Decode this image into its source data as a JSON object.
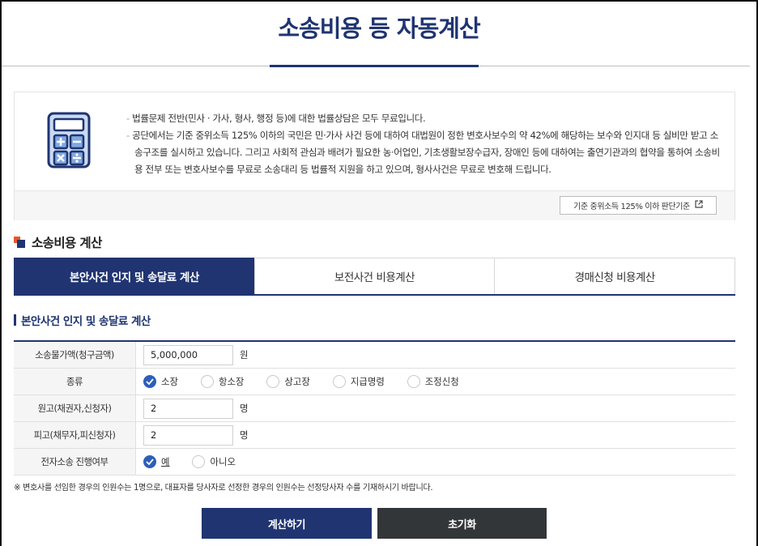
{
  "page": {
    "title": "소송비용 등 자동계산"
  },
  "info": {
    "lines": [
      "법률문제 전반(민사 · 가사, 형사, 행정 등)에 대한 법률상담은 모두 무료입니다.",
      "공단에서는 기준 중위소득 125% 이하의 국민은 민·가사 사건 등에 대하여 대법원이 정한 변호사보수의 약 42%에 해당하는 보수와 인지대 등 실비만 받고 소송구조를 실시하고 있습니다. 그리고 사회적 관심과 배려가 필요한 농·어업인, 기초생활보장수급자, 장애인 등에 대하여는 출연기관과의 협약을 통하여 소송비용 전부 또는 변호사보수를 무료로 소송대리 등 법률적 지원을 하고 있으며, 형사사건은 무료로 변호해 드립니다."
    ],
    "criteria_button": "기준 중위소득 125% 이하 판단기준",
    "icon": "calculator-icon"
  },
  "section": {
    "title": "소송비용 계산"
  },
  "tabs": [
    {
      "label": "본안사건 인지 및 송달료 계산",
      "active": true
    },
    {
      "label": "보전사건 비용계산",
      "active": false
    },
    {
      "label": "경매신청 비용계산",
      "active": false
    }
  ],
  "form": {
    "heading": "본안사건 인지 및 송달료 계산",
    "amount": {
      "label": "소송물가액(청구금액)",
      "value": "5,000,000",
      "unit": "원"
    },
    "type": {
      "label": "종류",
      "options": [
        "소장",
        "항소장",
        "상고장",
        "지급명령",
        "조정신청"
      ],
      "selected": "소장"
    },
    "plaintiff": {
      "label": "원고(채권자,신청자)",
      "value": "2",
      "unit": "명"
    },
    "defendant": {
      "label": "피고(채무자,피신청자)",
      "value": "2",
      "unit": "명"
    },
    "electronic": {
      "label": "전자소송 진행여부",
      "options": [
        "예",
        "아니오"
      ],
      "selected": "예"
    }
  },
  "note": "※ 변호사를 선임한 경우의 인원수는 1명으로, 대표자를 당사자로 선정한 경우의 인원수는 선정당사자 수를 기재하시기 바랍니다.",
  "buttons": {
    "calculate": "계산하기",
    "reset": "초기화"
  },
  "colors": {
    "primary": "#1f3471",
    "accent": "#e8552c",
    "radio_checked": "#2d5fb8",
    "reset_button": "#333639"
  }
}
